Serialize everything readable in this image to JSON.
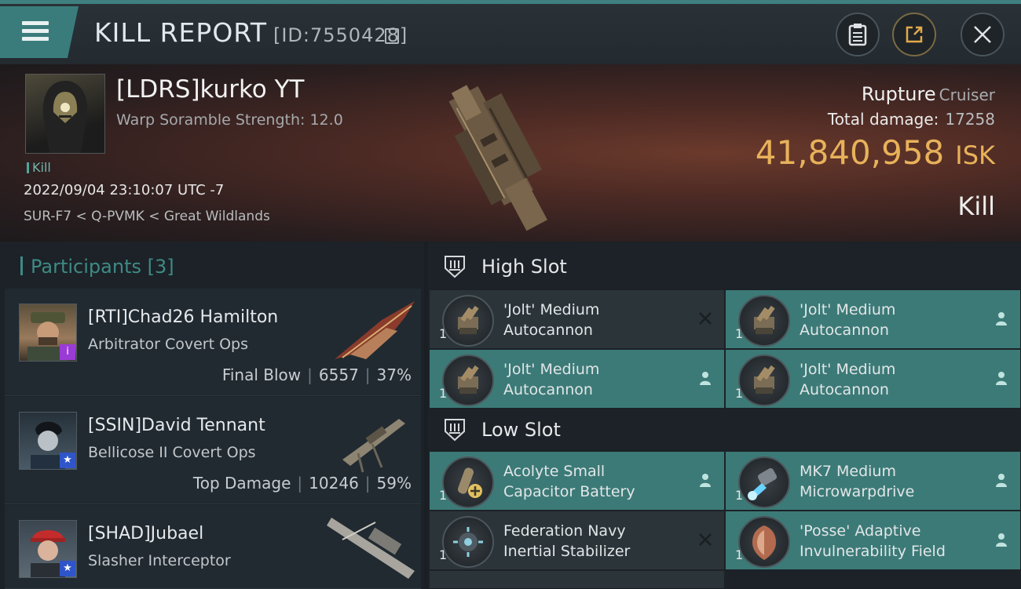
{
  "header": {
    "title": "KILL REPORT",
    "id_text": "[ID:7550428]",
    "menu_icon": "hamburger-icon",
    "buttons": [
      "clipboard-icon",
      "share-icon",
      "close-icon"
    ]
  },
  "victim": {
    "name": "[LDRS]kurko YT",
    "subtitle": "Warp Soramble Strength: 12.0",
    "tag": "Kill",
    "datetime": "2022/09/04 23:10:07 UTC -7",
    "location": "SUR-F7 < Q-PVMK < Great Wildlands",
    "ship_name": "Rupture",
    "ship_class": "Cruiser",
    "total_damage_label": "Total damage:",
    "total_damage": "17258",
    "isk_value": "41,840,958",
    "isk_unit": "ISK",
    "result": "Kill"
  },
  "participants": {
    "title": "Participants",
    "count": "[3]",
    "rows": [
      {
        "name": "[RTI]Chad26 Hamilton",
        "ship": "Arbitrator Covert Ops",
        "label": "Final Blow",
        "damage": "6557",
        "percent": "37%",
        "badge": "i",
        "badge_color": "#9b3bd6"
      },
      {
        "name": "[SSIN]David Tennant",
        "ship": "Bellicose II Covert Ops",
        "label": "Top Damage",
        "damage": "10246",
        "percent": "59%",
        "badge": "★",
        "badge_color": "#2f55c8"
      },
      {
        "name": "[SHAD]Jubael",
        "ship": "Slasher Interceptor",
        "label": "",
        "damage": "",
        "percent": "",
        "badge": "★",
        "badge_color": "#2f55c8"
      }
    ]
  },
  "slots": {
    "high_label": "High Slot",
    "low_label": "Low Slot",
    "high": [
      {
        "line1": "'Jolt' Medium",
        "line2": "Autocannon",
        "qty": "1",
        "status": "destroyed"
      },
      {
        "line1": "'Jolt' Medium",
        "line2": "Autocannon",
        "qty": "1",
        "status": "dropped"
      },
      {
        "line1": "'Jolt' Medium",
        "line2": "Autocannon",
        "qty": "1",
        "status": "dropped"
      },
      {
        "line1": "'Jolt' Medium",
        "line2": "Autocannon",
        "qty": "1",
        "status": "dropped"
      }
    ],
    "low": [
      {
        "line1": "Acolyte Small",
        "line2": "Capacitor Battery",
        "qty": "1",
        "status": "dropped"
      },
      {
        "line1": "MK7 Medium",
        "line2": "Microwarpdrive",
        "qty": "1",
        "status": "dropped"
      },
      {
        "line1": "Federation Navy",
        "line2": "Inertial Stabilizer",
        "qty": "1",
        "status": "destroyed"
      },
      {
        "line1": "'Posse' Adaptive",
        "line2": "Invulnerability Field",
        "qty": "1",
        "status": "dropped"
      }
    ]
  },
  "colors": {
    "accent": "#3f8a86",
    "isk": "#e8b25a",
    "dropped_bg": "#3c7a77",
    "destroyed_bg": "#2b3439"
  }
}
